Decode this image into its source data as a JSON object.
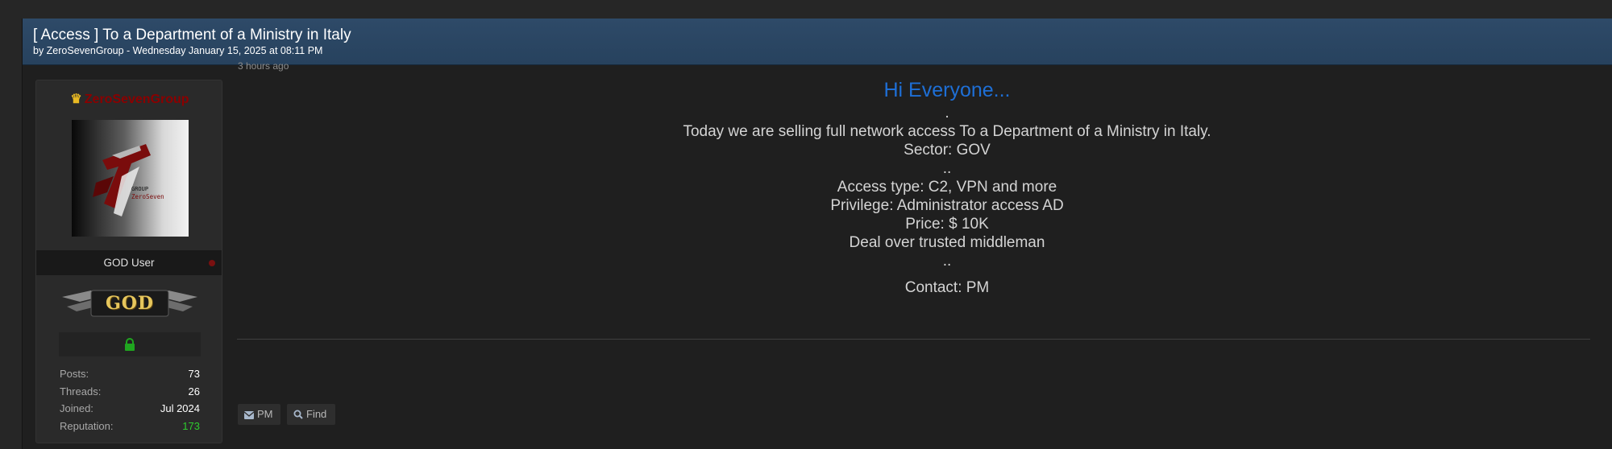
{
  "thread": {
    "title": "[ Access ] To a Department of a Ministry in Italy",
    "byline": "by ZeroSevenGroup - Wednesday January 15, 2025 at 08:11 PM"
  },
  "author": {
    "username": "ZeroSevenGroup",
    "avatar_text_top": "GROUP",
    "avatar_text_bottom": "ZeroSeven",
    "user_title": "GOD User",
    "rank_label": "GOD",
    "stats": [
      {
        "label": "Posts:",
        "value": "73"
      },
      {
        "label": "Threads:",
        "value": "26"
      },
      {
        "label": "Joined:",
        "value": "Jul 2024"
      },
      {
        "label": "Reputation:",
        "value": "173"
      }
    ],
    "colors": {
      "username": "#8b0000",
      "reputation": "#2ecc2e",
      "crown": "#e8b923",
      "lock": "#1fa51f"
    }
  },
  "post": {
    "time": "3 hours ago",
    "greeting": "Hi Everyone...",
    "lines": [
      ".",
      "Today we are selling full network access To a Department of a Ministry in Italy.",
      "Sector: GOV",
      "..",
      "Access type: C2, VPN and more",
      "Privilege: Administrator access AD",
      "Price: $ 10K",
      "Deal over trusted middleman",
      ".."
    ],
    "contact": "Contact: PM",
    "greeting_color": "#1e6fd6"
  },
  "buttons": {
    "pm": {
      "label": "PM",
      "icon": "envelope-icon"
    },
    "find": {
      "label": "Find",
      "icon": "search-icon"
    }
  }
}
